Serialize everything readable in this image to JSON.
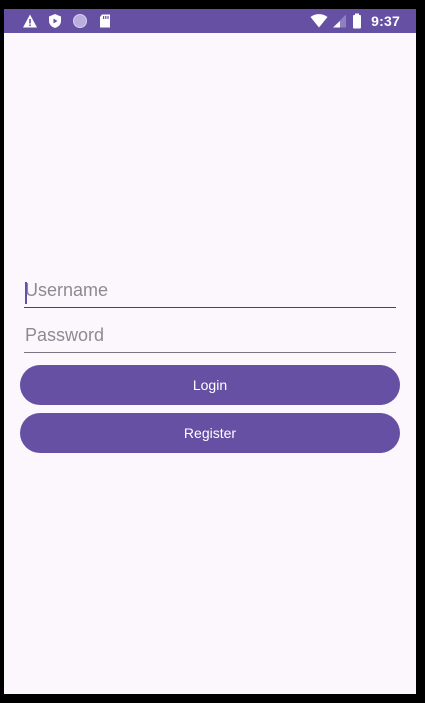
{
  "status_bar": {
    "time": "9:37",
    "left_icons": [
      "warning-icon",
      "shield-play-icon",
      "circle-icon",
      "sd-card-icon"
    ],
    "right_icons": [
      "wifi-icon",
      "signal-icon",
      "battery-icon"
    ],
    "background": "#6650a4"
  },
  "form": {
    "username": {
      "placeholder": "Username",
      "value": ""
    },
    "password": {
      "placeholder": "Password",
      "value": ""
    },
    "login_label": "Login",
    "register_label": "Register"
  },
  "colors": {
    "accent": "#6650a4",
    "screen_background": "#fcf6fd"
  }
}
